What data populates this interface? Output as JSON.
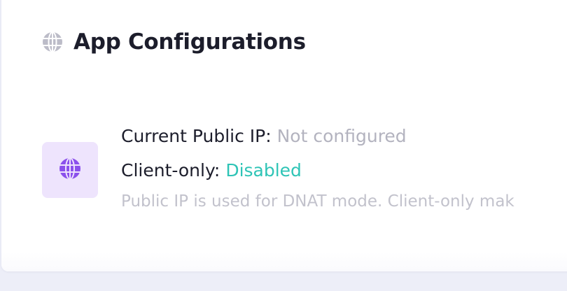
{
  "colors": {
    "page_bg": "#edeef8",
    "card_bg": "#ffffff",
    "title": "#1c1d2b",
    "muted": "#b3b3bf",
    "status_ok": "#2ec4b6",
    "icon_tile_bg": "#eee4fd",
    "icon_accent": "#8b50ec",
    "header_icon": "#bcbcc8"
  },
  "header": {
    "icon": "globe-icon",
    "title": "App Configurations"
  },
  "app_config": {
    "icon": "globe-icon",
    "public_ip": {
      "label": "Current Public IP:",
      "value": "Not configured"
    },
    "client_only": {
      "label": "Client-only:",
      "value": "Disabled"
    },
    "description": "Public IP is used for DNAT mode. Client-only mak"
  }
}
